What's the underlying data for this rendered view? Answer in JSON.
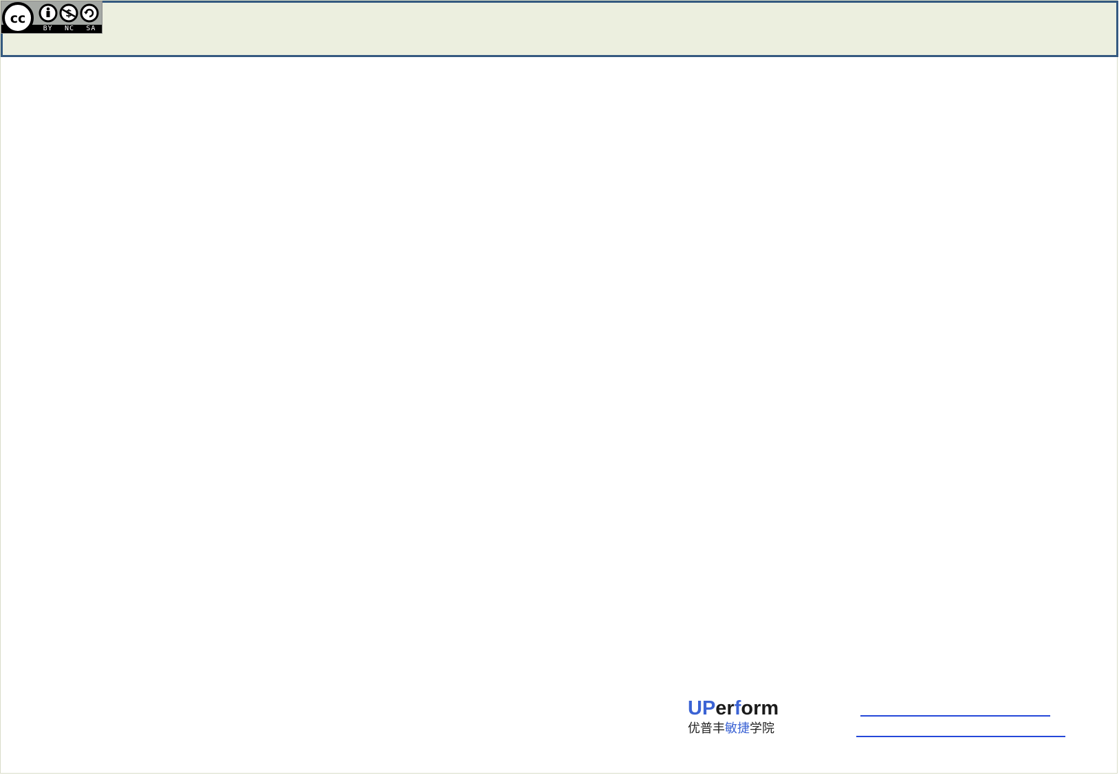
{
  "header": {
    "license_badge": {
      "icon": "creative-commons-by-nc-sa-icon",
      "terms": [
        "BY",
        "NC",
        "SA"
      ]
    }
  },
  "footer": {
    "logo": {
      "name_parts": [
        "UP",
        "er",
        "f",
        "orm"
      ],
      "subtitle_parts": [
        "优普丰",
        "敏捷",
        "学院"
      ],
      "colors": {
        "accent": "#3b63d4",
        "text": "#1b1b1b"
      }
    },
    "links": [
      {
        "text": ""
      },
      {
        "text": ""
      }
    ],
    "link_color": "#2447d8"
  },
  "theme": {
    "header_background": "#ecefdf",
    "header_border": "#34597f"
  }
}
